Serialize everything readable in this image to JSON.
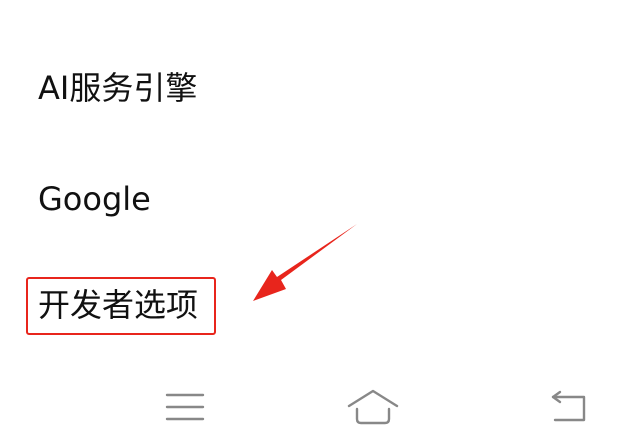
{
  "settings": {
    "items": [
      {
        "label": "AI服务引擎"
      },
      {
        "label": "Google"
      },
      {
        "label": "开发者选项"
      }
    ]
  },
  "annotation": {
    "color": "#e8251c",
    "highlighted_item": "开发者选项"
  },
  "nav_bar": {
    "buttons": [
      {
        "icon": "menu-icon"
      },
      {
        "icon": "home-icon"
      },
      {
        "icon": "back-icon"
      }
    ],
    "icon_color": "#888888"
  }
}
